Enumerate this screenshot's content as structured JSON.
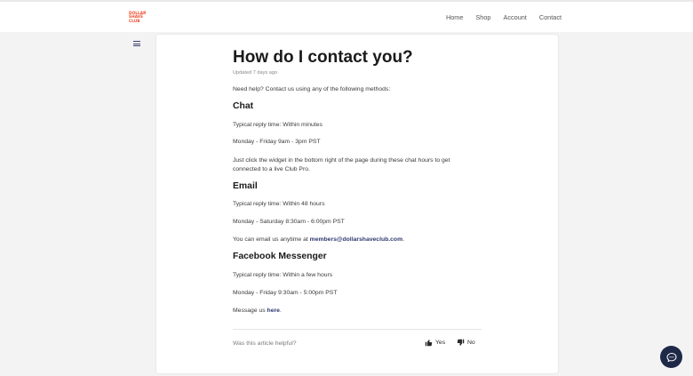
{
  "header": {
    "logo_lines": [
      "DOLLAR",
      "SHAVE",
      "CLUB"
    ],
    "nav": [
      "Home",
      "Shop",
      "Account",
      "Contact"
    ]
  },
  "article": {
    "title": "How do I contact you?",
    "updated": "Updated 7 days ago",
    "intro": "Need help? Contact us using any of the following methods:",
    "chat": {
      "heading": "Chat",
      "reply_time": "Typical reply time: Within minutes",
      "hours": "Monday - Friday 9am - 3pm PST",
      "detail": "Just click the widget in the bottom right of the page during these chat hours to get connected to a live Club Pro."
    },
    "email": {
      "heading": "Email",
      "reply_time": "Typical reply time: Within 48 hours",
      "hours": "Monday - Saturday 8:30am - 6:00pm PST",
      "detail_prefix": "You can email us anytime at ",
      "detail_link": "members@dollarshaveclub.com",
      "detail_suffix": "."
    },
    "messenger": {
      "heading": "Facebook Messenger",
      "reply_time": "Typical reply time: Within a few hours",
      "hours": "Monday - Friday 9:30am - 5:00pm PST",
      "detail_prefix": "Message us ",
      "detail_link": "here",
      "detail_suffix": "."
    }
  },
  "feedback": {
    "question": "Was this article helpful?",
    "yes": "Yes",
    "no": "No"
  },
  "colors": {
    "brand": "#f04a2b",
    "link": "#2d3a6e",
    "chat_launcher": "#1e2847"
  },
  "icons": [
    "list-icon",
    "thumbs-up-icon",
    "thumbs-down-icon",
    "chat-bubble-icon"
  ]
}
